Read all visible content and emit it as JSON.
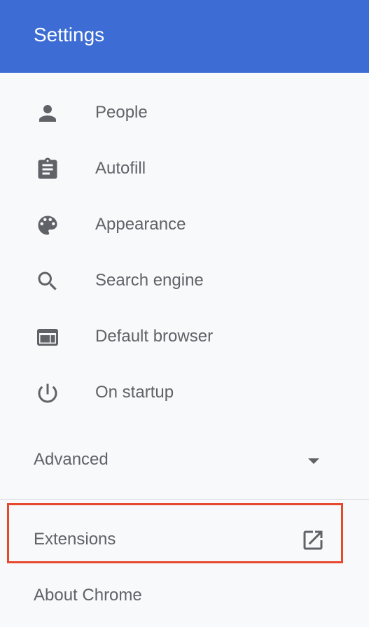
{
  "header": {
    "title": "Settings",
    "background_color": "#3c6cd4"
  },
  "menu": {
    "items": [
      {
        "label": "People",
        "icon": "person-icon"
      },
      {
        "label": "Autofill",
        "icon": "clipboard-icon"
      },
      {
        "label": "Appearance",
        "icon": "palette-icon"
      },
      {
        "label": "Search engine",
        "icon": "search-icon"
      },
      {
        "label": "Default browser",
        "icon": "browser-window-icon"
      },
      {
        "label": "On startup",
        "icon": "power-icon"
      }
    ],
    "advanced": {
      "label": "Advanced",
      "icon": "dropdown-arrow-icon"
    },
    "extensions": {
      "label": "Extensions",
      "icon": "open-in-new-icon",
      "highlight_color": "#e64a2e"
    },
    "about": {
      "label": "About Chrome"
    }
  }
}
